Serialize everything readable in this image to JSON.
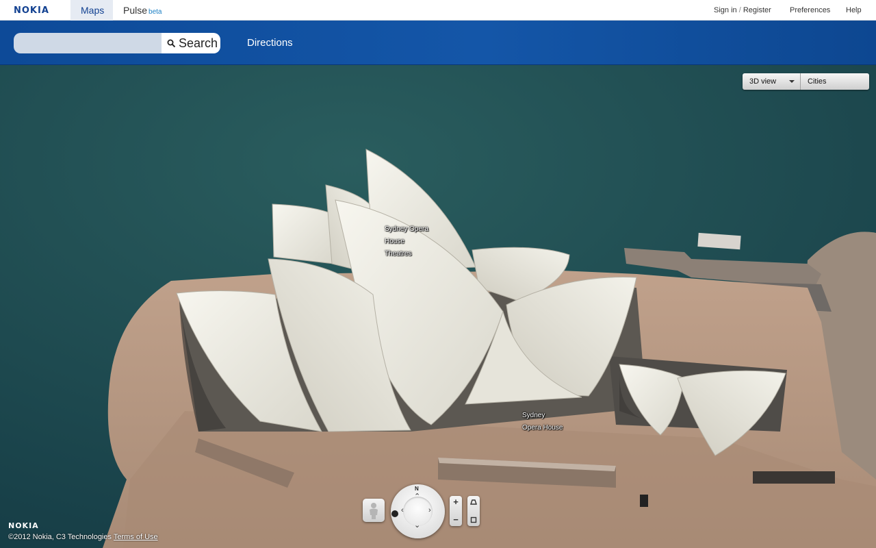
{
  "header": {
    "logo": "NOKIA",
    "tabs": [
      {
        "label": "Maps",
        "active": true
      },
      {
        "label": "Pulse",
        "badge": "beta",
        "active": false
      }
    ],
    "links": {
      "sign_in": "Sign in",
      "separator": "/",
      "register": "Register",
      "preferences": "Preferences",
      "help": "Help"
    }
  },
  "search": {
    "value": "",
    "placeholder": "",
    "button_label": "Search",
    "directions_label": "Directions"
  },
  "map_controls": {
    "view_mode": "3D view",
    "cities_label": "Cities"
  },
  "map_labels": {
    "theatres": [
      "Sydney Opera",
      "House",
      "Theatres"
    ],
    "opera_house": [
      "Sydney",
      "Opera House"
    ]
  },
  "navigation": {
    "compass_north": "N",
    "zoom_in": "+",
    "zoom_out": "−"
  },
  "footer": {
    "logo": "NOKIA",
    "copyright": "©2012 Nokia, C3 Technologies",
    "terms_link": "Terms of Use"
  },
  "colors": {
    "brand_blue": "#124191",
    "bar_blue": "#1456a8",
    "water": "#1e4a52",
    "pier": "#b99a84",
    "shell": "#efeee6"
  }
}
